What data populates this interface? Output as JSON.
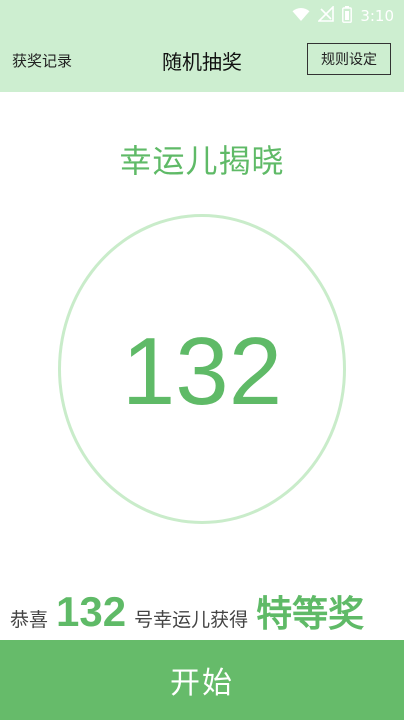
{
  "status_bar": {
    "time": "3:10",
    "icons": [
      "wifi-icon",
      "signal-off-icon",
      "battery-icon"
    ]
  },
  "header": {
    "left_link": "获奖记录",
    "title": "随机抽奖",
    "right_button": "规则设定"
  },
  "main": {
    "reveal_title": "幸运儿揭晓",
    "current_number": "132"
  },
  "result": {
    "prefix": "恭喜",
    "number": "132",
    "middle": "号幸运儿获得",
    "prize": "特等奖"
  },
  "footer": {
    "start_label": "开始"
  },
  "colors": {
    "accent": "#66bb6a",
    "accent_text": "#5fba67",
    "header_bg": "#cdeed0",
    "circle_border": "#c9ecca"
  }
}
